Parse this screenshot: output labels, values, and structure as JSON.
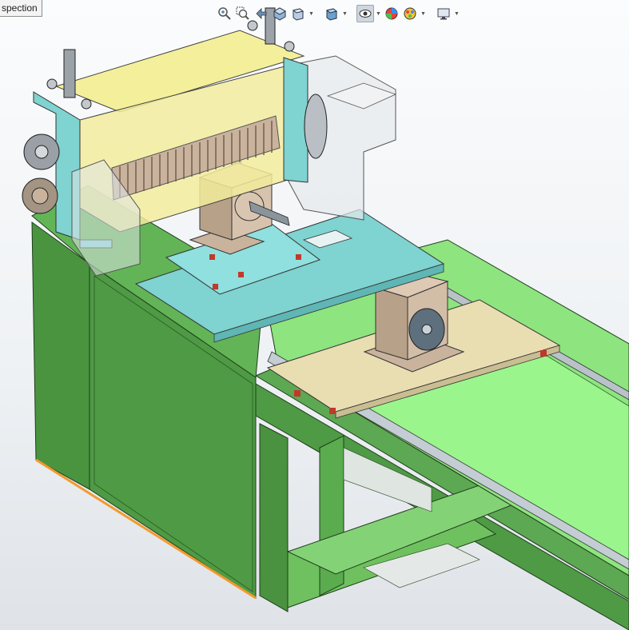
{
  "tab": {
    "label": "spection"
  },
  "toolbar": {
    "buttons": [
      {
        "name": "zoom-to-fit-icon",
        "active": false,
        "dropdown": false
      },
      {
        "name": "zoom-to-area-icon",
        "active": false,
        "dropdown": false
      },
      {
        "name": "previous-view-icon",
        "active": false,
        "dropdown": false
      },
      {
        "name": "section-view-icon",
        "active": false,
        "dropdown": false
      },
      {
        "name": "view-orientation-icon",
        "active": false,
        "dropdown": true
      },
      {
        "name": "display-style-icon",
        "active": false,
        "dropdown": true
      },
      {
        "name": "hide-show-items-icon",
        "active": true,
        "dropdown": true
      },
      {
        "name": "edit-appearance-icon",
        "active": false,
        "dropdown": false
      },
      {
        "name": "apply-scene-icon",
        "active": false,
        "dropdown": true
      },
      {
        "name": "view-settings-icon",
        "active": false,
        "dropdown": true
      }
    ]
  },
  "model": {
    "description": "",
    "colors": {
      "frame_green": "#4f9a45",
      "frame_dark": "#3b7a34",
      "frame_light": "#7fcf6e",
      "bed_green": "#9bf58d",
      "cyan_plate": "#7fd3d1",
      "cream_plate": "#e9ddb2",
      "housing_yellow": "#f4ef9a",
      "part_tan": "#c9b39d",
      "rail_gray": "#b9c2c8",
      "orange_edge": "#f29a2e"
    }
  }
}
